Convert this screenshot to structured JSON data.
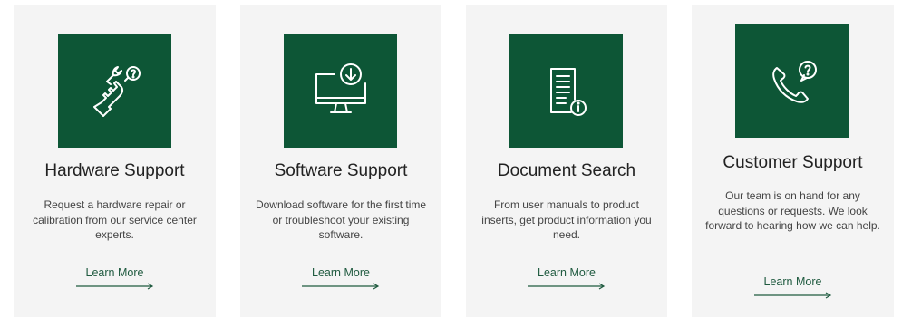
{
  "cards": [
    {
      "title": "Hardware Support",
      "description": "Request a hardware repair or calibration from our service center experts.",
      "link_label": "Learn More",
      "icon": "hardware-repair-icon"
    },
    {
      "title": "Software Support",
      "description": "Download software for the first time or troubleshoot your existing software.",
      "link_label": "Learn More",
      "icon": "software-download-icon"
    },
    {
      "title": "Document Search",
      "description": "From user manuals to product inserts, get product information you need.",
      "link_label": "Learn More",
      "icon": "document-info-icon"
    },
    {
      "title": "Customer Support",
      "description": "Our team is on hand for any questions or requests. We look forward to hearing how we can help.",
      "link_label": "Learn More",
      "icon": "phone-support-icon"
    }
  ],
  "colors": {
    "icon_bg": "#0d5636",
    "card_bg": "#f4f4f4",
    "link": "#1f5a3f",
    "title": "#222222",
    "body": "#444444"
  }
}
